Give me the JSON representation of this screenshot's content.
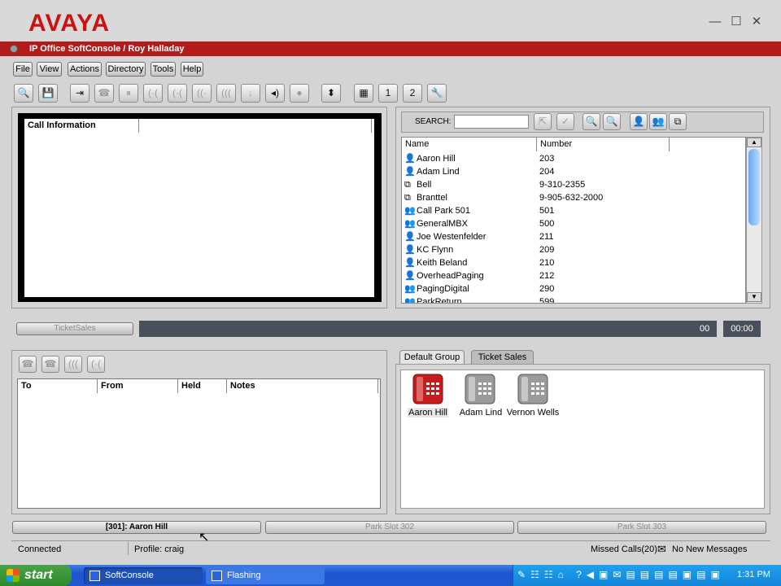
{
  "app": {
    "logo": "AVAYA",
    "title": "IP Office SoftConsole / Roy Halladay"
  },
  "window_controls": {
    "minimize": "—",
    "maximize": "☐",
    "close": "✕"
  },
  "menu": [
    "File",
    "View",
    "Actions",
    "Directory",
    "Tools",
    "Help"
  ],
  "toolbar_icons": [
    "search-icon",
    "save-icon",
    "transfer-icon",
    "answer-icon",
    "hold-icon",
    "conference-icon",
    "park-icon",
    "unpark-icon",
    "call-icon",
    "release-icon",
    "volume-icon",
    "record-icon",
    "updown-icon",
    "keypad-icon",
    "one-icon",
    "two-icon",
    "wrench-icon"
  ],
  "call_info": {
    "header": "Call Information"
  },
  "search": {
    "label": "SEARCH:",
    "value": ""
  },
  "directory": {
    "columns": [
      "Name",
      "Number"
    ],
    "rows": [
      {
        "icon": "person-icon",
        "name": "Aaron Hill",
        "number": "203"
      },
      {
        "icon": "person-icon",
        "name": "Adam Lind",
        "number": "204"
      },
      {
        "icon": "external-icon",
        "name": "Bell",
        "number": "9-310-2355"
      },
      {
        "icon": "external-icon",
        "name": "Branttel",
        "number": "9-905-632-2000"
      },
      {
        "icon": "group-icon",
        "name": "Call Park 501",
        "number": "501"
      },
      {
        "icon": "group-icon",
        "name": "GeneralMBX",
        "number": "500"
      },
      {
        "icon": "person-icon",
        "name": "Joe Westenfelder",
        "number": "211"
      },
      {
        "icon": "person-icon",
        "name": "KC Flynn",
        "number": "209"
      },
      {
        "icon": "person-icon",
        "name": "Keith Beland",
        "number": "210"
      },
      {
        "icon": "person-icon",
        "name": "OverheadPaging",
        "number": "212"
      },
      {
        "icon": "group-icon",
        "name": "PagingDigital",
        "number": "290"
      },
      {
        "icon": "group-icon",
        "name": "ParkReturn",
        "number": "599"
      }
    ]
  },
  "queue": {
    "label": "TicketSales",
    "count": "00",
    "time": "00:00"
  },
  "held": {
    "columns": [
      "To",
      "From",
      "Held",
      "Notes"
    ]
  },
  "groups": {
    "tabs": [
      "Default Group",
      "Ticket Sales"
    ],
    "active": "Ticket Sales",
    "members": [
      {
        "name": "Aaron Hill",
        "color": "#c81c1c"
      },
      {
        "name": "Adam Lind",
        "color": "#9a9a9a"
      },
      {
        "name": "Vernon Wells",
        "color": "#9a9a9a"
      }
    ]
  },
  "park_slots": [
    "[301]: Aaron Hill",
    "Park Slot 302",
    "Park Slot 303"
  ],
  "status": {
    "connection": "Connected",
    "profile": "Profile: craig",
    "missed": "Missed Calls(20)",
    "messages": "No New Messages"
  },
  "taskbar": {
    "start": "start",
    "tasks": [
      "SoftConsole",
      "Flashing"
    ],
    "clock": "1:31 PM"
  }
}
